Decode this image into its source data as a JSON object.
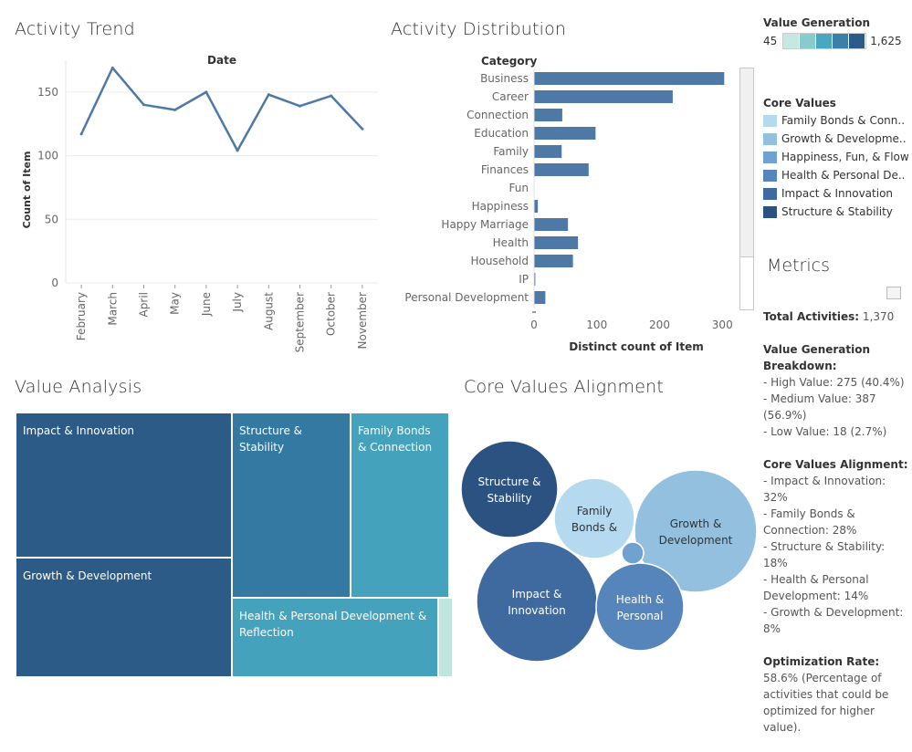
{
  "titles": {
    "activity_trend": "Activity Trend",
    "activity_distribution": "Activity Distribution",
    "value_analysis": "Value Analysis",
    "core_values_alignment": "Core Values Alignment",
    "metrics": "Metrics"
  },
  "value_generation_legend": {
    "title": "Value Generation",
    "min": "45",
    "max": "1,625",
    "colors": [
      "#c6e8e0",
      "#87cbcc",
      "#4aa7c0",
      "#3b7fab",
      "#2d5b88"
    ]
  },
  "core_values_legend": {
    "title": "Core Values",
    "items": [
      {
        "label": "Family Bonds & Conn..",
        "color": "#b5d9ee"
      },
      {
        "label": "Growth & Developme..",
        "color": "#93c0df"
      },
      {
        "label": "Happiness, Fun, & Flow",
        "color": "#6fa2cf"
      },
      {
        "label": "Health & Personal De..",
        "color": "#5585ba"
      },
      {
        "label": "Impact & Innovation",
        "color": "#3e6aa0"
      },
      {
        "label": "Structure & Stability",
        "color": "#2c5282"
      }
    ]
  },
  "metrics": {
    "total_label": "Total Activities:",
    "total_value": "1,370",
    "value_gen_heading": "Value Generation Breakdown:",
    "value_gen_lines": [
      "- High Value: 275 (40.4%)",
      "- Medium Value: 387 (56.9%)",
      "- Low Value: 18 (2.7%)"
    ],
    "core_align_heading": "Core Values Alignment:",
    "core_align_lines": [
      "- Impact & Innovation: 32%",
      "- Family Bonds & Connection: 28%",
      "- Structure & Stability: 18%",
      "- Health & Personal Development: 14%",
      "- Growth & Development: 8%"
    ],
    "opt_label": "Optimization Rate:",
    "opt_value": "58.6%",
    "opt_desc": "(Percentage of activities that could be optimized for higher value)."
  },
  "treemap": [
    {
      "label": "Impact & Innovation",
      "color": "#2d5b88"
    },
    {
      "label": "Growth & Development",
      "color": "#2d5b88"
    },
    {
      "label": "Structure & Stability",
      "color": "#3479a2"
    },
    {
      "label": "Family Bonds & Connection",
      "color": "#45a2bc"
    },
    {
      "label": "Health & Personal Development & Reflection",
      "color": "#45a2bc"
    },
    {
      "label": "",
      "color": "#bfe6dc"
    }
  ],
  "bubbles": [
    {
      "label": "Structure & Stability",
      "color": "#2c5282",
      "text_color": "#ffffff"
    },
    {
      "label": "Family Bonds &",
      "color": "#b5d9ee",
      "text_color": "#333333"
    },
    {
      "label": "Growth & Development",
      "color": "#93c0df",
      "text_color": "#333333"
    },
    {
      "label": "Impact & Innovation",
      "color": "#3e6aa0",
      "text_color": "#ffffff"
    },
    {
      "label": "Health & Personal",
      "color": "#5585ba",
      "text_color": "#ffffff"
    },
    {
      "label": "",
      "color": "#6fa2cf",
      "text_color": "#ffffff"
    }
  ],
  "chart_data": [
    {
      "type": "line",
      "title": "Activity Trend",
      "xlabel": "Date",
      "ylabel": "Count of Item",
      "categories": [
        "February",
        "March",
        "April",
        "May",
        "June",
        "July",
        "August",
        "September",
        "October",
        "November"
      ],
      "values": [
        117,
        169,
        140,
        136,
        150,
        104,
        148,
        139,
        147,
        121
      ],
      "ylim": [
        0,
        175
      ],
      "yticks": [
        0,
        50,
        100,
        150
      ],
      "grid": true,
      "color": "#4e79a7"
    },
    {
      "type": "bar",
      "orientation": "horizontal",
      "title": "Activity Distribution",
      "category_header": "Category",
      "xlabel": "Distinct count of Item",
      "categories": [
        "Business",
        "Career",
        "Connection",
        "Education",
        "Family",
        "Finances",
        "Fun",
        "Happiness",
        "Happy Marriage",
        "Health",
        "Household",
        "IP",
        "Personal Development"
      ],
      "values": [
        303,
        221,
        45,
        98,
        44,
        87,
        0,
        6,
        54,
        70,
        62,
        2,
        18
      ],
      "xlim": [
        0,
        320
      ],
      "xticks": [
        0,
        100,
        200,
        300
      ],
      "color": "#4e79a7"
    }
  ]
}
